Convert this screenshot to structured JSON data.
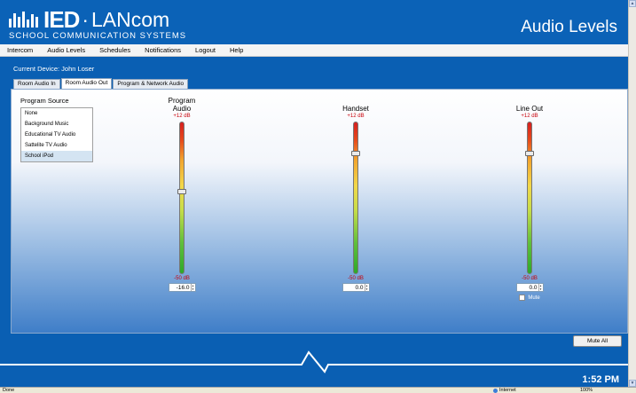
{
  "header": {
    "logo_main": "IED",
    "logo_sep": "·",
    "logo_brand": "LANcom",
    "logo_sub": "SCHOOL COMMUNICATION SYSTEMS",
    "page_title": "Audio Levels"
  },
  "menu": [
    "Intercom",
    "Audio Levels",
    "Schedules",
    "Notifications",
    "Logout",
    "Help"
  ],
  "device_label": "Current Device: John Loser",
  "tabs": [
    "Room Audio In",
    "Room Audio Out",
    "Program & Network Audio"
  ],
  "active_tab": "Room Audio Out",
  "program_source": {
    "title": "Program Source",
    "options": [
      "None",
      "Background Music",
      "Educational TV Audio",
      "Sattelite TV Audio",
      "School iPod"
    ],
    "selected": "School iPod"
  },
  "faders": [
    {
      "name": "Program Audio",
      "line1": "Program",
      "line2": "Audio",
      "max_label": "+12 dB",
      "min_label": "-50 dB",
      "value": "-16.0",
      "level_db": -16.0,
      "mute": null
    },
    {
      "name": "Handset",
      "line1": "",
      "line2": "Handset",
      "max_label": "+12 dB",
      "min_label": "-50 dB",
      "value": "0.0",
      "level_db": 0.0,
      "mute": null
    },
    {
      "name": "Line Out",
      "line1": "",
      "line2": "Line Out",
      "max_label": "+12 dB",
      "min_label": "-50 dB",
      "value": "0.0",
      "level_db": 0.0,
      "mute": {
        "label": "Mute",
        "checked": false
      }
    }
  ],
  "mute_all_label": "Mute All",
  "time": "1:52 PM",
  "statusbar": {
    "left": "Done",
    "zone": "Internet",
    "zoom": "100%"
  },
  "colors": {
    "header_bg": "#0b62b7",
    "accent_red": "#c8000a"
  }
}
